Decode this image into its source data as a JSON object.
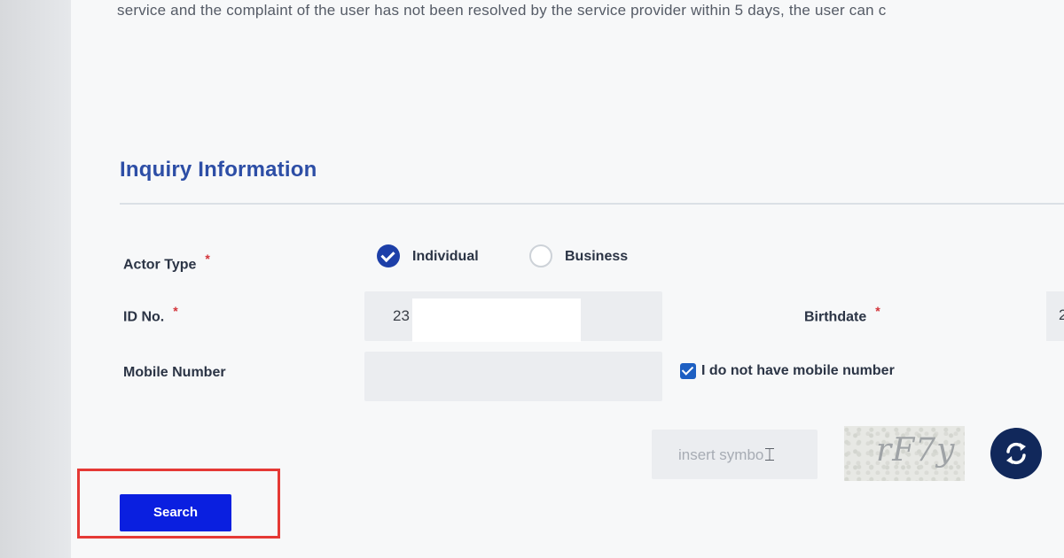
{
  "intro_text": "service and the complaint of the user has not been resolved by the service provider within 5 days, the user can c",
  "section_title": "Inquiry Information",
  "form": {
    "actor_type": {
      "label": "Actor Type",
      "required_mark": "*",
      "options": [
        {
          "label": "Individual",
          "selected": true
        },
        {
          "label": "Business",
          "selected": false
        }
      ]
    },
    "id_no": {
      "label": "ID No.",
      "required_mark": "*",
      "value": "23"
    },
    "birthdate": {
      "label": "Birthdate",
      "required_mark": "*",
      "value": "2"
    },
    "mobile_number": {
      "label": "Mobile Number",
      "value": ""
    },
    "no_mobile_checkbox": {
      "label": "I do not have mobile number",
      "checked": true
    },
    "captcha": {
      "placeholder": "insert symbo",
      "image_text": "rF7y"
    },
    "search_button": "Search"
  },
  "colors": {
    "title": "#2d4ea6",
    "search_button": "#0a1fe0",
    "highlight": "#e53935",
    "refresh_button": "#11285b",
    "required_mark": "#d3343a"
  },
  "icons": {
    "refresh": "refresh-icon",
    "cursor": "text-cursor-icon"
  }
}
